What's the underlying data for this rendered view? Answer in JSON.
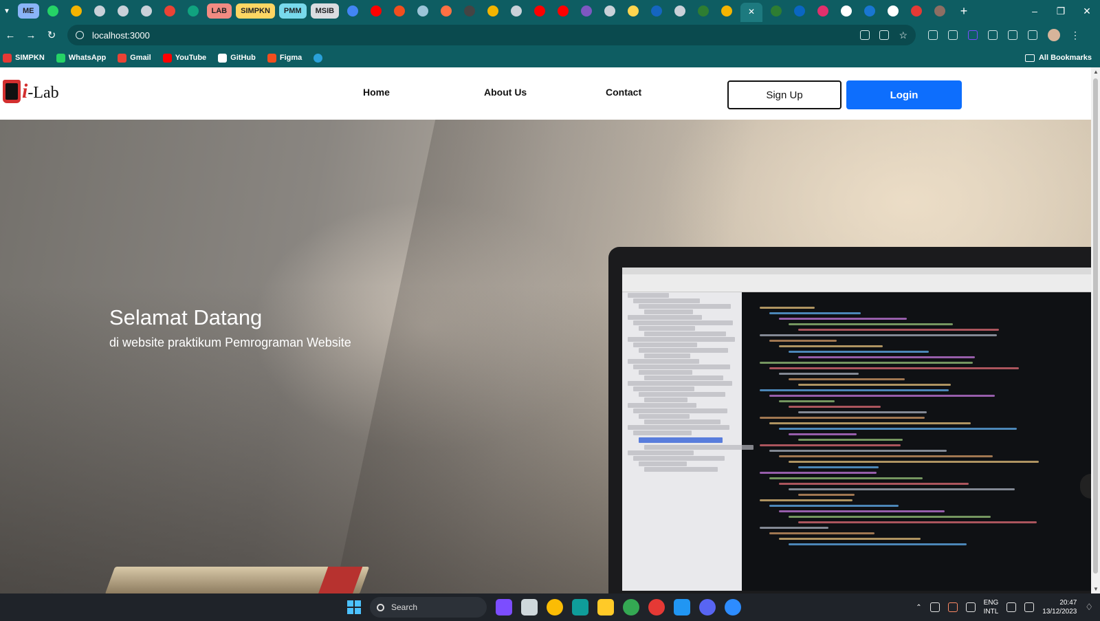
{
  "browser": {
    "tabs": [
      {
        "label": "ME",
        "color": "#8ab4f8",
        "pill": true
      },
      {
        "icon": "whatsapp-icon",
        "color": "#25d366"
      },
      {
        "icon": "drive-icon",
        "color": "#f4b400"
      },
      {
        "icon": "chatgpt-icon",
        "color": "#c9d1d9"
      },
      {
        "icon": "chatgpt-icon",
        "color": "#c9d1d9"
      },
      {
        "icon": "chatgpt-icon",
        "color": "#c9d1d9"
      },
      {
        "icon": "gmail-icon",
        "color": "#ea4335"
      },
      {
        "icon": "chatgpt-icon",
        "color": "#10a37f"
      },
      {
        "label": "LAB",
        "color": "#f28b82",
        "pill": true
      },
      {
        "label": "SIMPKN",
        "color": "#fdd663",
        "pill": true
      },
      {
        "label": "PMM",
        "color": "#78d9ec",
        "pill": true
      },
      {
        "label": "MSIB",
        "color": "#dadce0",
        "pill": true
      },
      {
        "icon": "docs-icon",
        "color": "#4285f4"
      },
      {
        "icon": "youtube-icon",
        "color": "#ff0000"
      },
      {
        "icon": "figma-icon",
        "color": "#f24e1e"
      },
      {
        "icon": "edge-icon",
        "color": "#9cc4d8"
      },
      {
        "icon": "app-icon",
        "color": "#ff7043"
      },
      {
        "icon": "app-icon",
        "color": "#444444"
      },
      {
        "icon": "drive-icon",
        "color": "#f4b400"
      },
      {
        "icon": "gear-icon",
        "color": "#c9d1d9"
      },
      {
        "icon": "youtube-icon",
        "color": "#ff0000"
      },
      {
        "icon": "youtube-icon",
        "color": "#ff0000"
      },
      {
        "icon": "app-icon",
        "color": "#7e57c2"
      },
      {
        "icon": "chatgpt-icon",
        "color": "#c9d1d9"
      },
      {
        "icon": "lock-icon",
        "color": "#ffd54f"
      },
      {
        "icon": "app-icon",
        "color": "#1565c0"
      },
      {
        "icon": "globe-icon",
        "color": "#c9d1d9"
      },
      {
        "icon": "word-icon",
        "color": "#2e7d32"
      },
      {
        "icon": "drive-icon",
        "color": "#f4b400"
      },
      {
        "icon": "close-icon",
        "color": "#ffffff",
        "active": true
      },
      {
        "icon": "word-icon",
        "color": "#2e7d32"
      },
      {
        "icon": "linkedin-icon",
        "color": "#0a66c2"
      },
      {
        "icon": "instagram-icon",
        "color": "#e1306c"
      },
      {
        "icon": "google-icon",
        "color": "#ffffff"
      },
      {
        "icon": "app-icon",
        "color": "#1976d2"
      },
      {
        "icon": "google-icon",
        "color": "#ffffff"
      },
      {
        "icon": "app-icon",
        "color": "#e53935"
      },
      {
        "icon": "app-icon",
        "color": "#8d6e63"
      }
    ],
    "address": "localhost:3000",
    "bookmarks": [
      {
        "label": "SIMPKN",
        "color": "#e53935",
        "icon": "simpkn-icon"
      },
      {
        "label": "WhatsApp",
        "color": "#25d366",
        "icon": "whatsapp-icon"
      },
      {
        "label": "Gmail",
        "color": "#ea4335",
        "icon": "gmail-icon"
      },
      {
        "label": "YouTube",
        "color": "#ff0000",
        "icon": "youtube-icon"
      },
      {
        "label": "GitHub",
        "color": "#ffffff",
        "icon": "github-icon"
      },
      {
        "label": "Figma",
        "color": "#f24e1e",
        "icon": "figma-icon"
      },
      {
        "label": "",
        "color": "#2aa1da",
        "icon": "telegram-icon"
      }
    ],
    "all_bookmarks": "All Bookmarks"
  },
  "site": {
    "logo_i": "i",
    "logo_text": "-Lab",
    "nav": [
      {
        "label": "Home"
      },
      {
        "label": "About Us"
      },
      {
        "label": "Contact"
      }
    ],
    "signup": "Sign Up",
    "login": "Login",
    "hero_title": "Selamat Datang",
    "hero_subtitle": "di website praktikum Pemrograman Website"
  },
  "taskbar": {
    "search_label": "Search",
    "apps": [
      {
        "icon": "copilot-icon",
        "color": "#7c4dff"
      },
      {
        "icon": "task-view-icon",
        "color": "#cfd8dc"
      },
      {
        "icon": "chrome-icon",
        "color": "#fbbc04"
      },
      {
        "icon": "edge-icon",
        "color": "#0f9d9a"
      },
      {
        "icon": "file-explorer-icon",
        "color": "#ffca28"
      },
      {
        "icon": "chrome-icon",
        "color": "#34a853"
      },
      {
        "icon": "telegram-icon",
        "color": "#e53935"
      },
      {
        "icon": "vscode-icon",
        "color": "#2196f3"
      },
      {
        "icon": "discord-icon",
        "color": "#5865f2"
      },
      {
        "icon": "zoom-icon",
        "color": "#2d8cff"
      }
    ],
    "lang_top": "ENG",
    "lang_bottom": "INTL",
    "time": "20:47",
    "date": "13/12/2023"
  }
}
